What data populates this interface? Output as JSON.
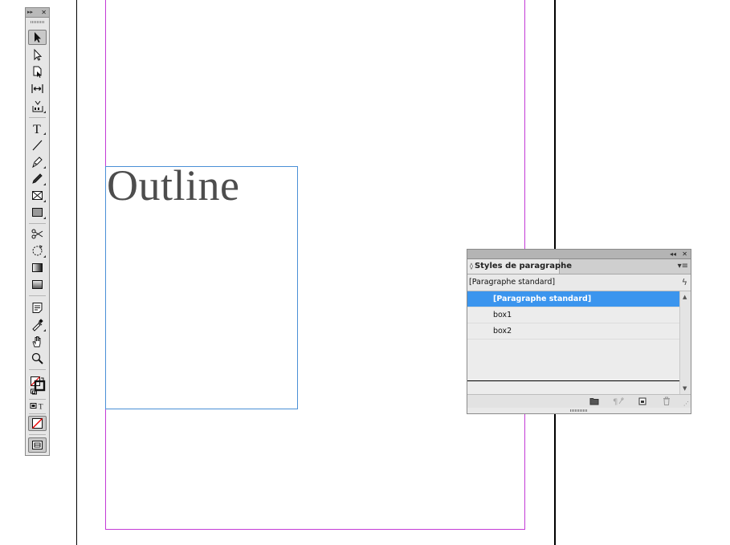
{
  "document": {
    "story_text": "Outline",
    "colors": {
      "margin_guide": "#c43bd6",
      "frame_edge": "#4a8fd6",
      "text": "#4d4d4d"
    }
  },
  "tools_panel": {
    "collapse_icon": "double-chevron-right-icon",
    "close_icon": "close-icon",
    "tools": [
      "selection-tool",
      "direct-selection-tool",
      "page-tool",
      "gap-tool",
      "content-collector-tool",
      "type-tool",
      "line-tool",
      "pen-tool",
      "pencil-tool",
      "rectangle-frame-tool",
      "rectangle-tool",
      "scissors-tool",
      "free-transform-tool",
      "gradient-swatch-tool",
      "gradient-feather-tool",
      "note-tool",
      "eyedropper-tool",
      "hand-tool",
      "zoom-tool",
      "fill-stroke-swatches",
      "formatting-container-text",
      "apply-none",
      "screen-mode"
    ]
  },
  "paragraph_styles_panel": {
    "title": "Styles de paragraphe",
    "current_style": "[Paragraphe standard]",
    "styles": [
      {
        "label": "[Paragraphe standard]",
        "selected": true
      },
      {
        "label": "box1",
        "selected": false
      },
      {
        "label": "box2",
        "selected": false
      }
    ],
    "accent_color": "#3b95ee",
    "footer_buttons": [
      "new-style-group-icon",
      "clear-overrides-icon",
      "create-new-style-icon",
      "delete-style-icon"
    ]
  }
}
